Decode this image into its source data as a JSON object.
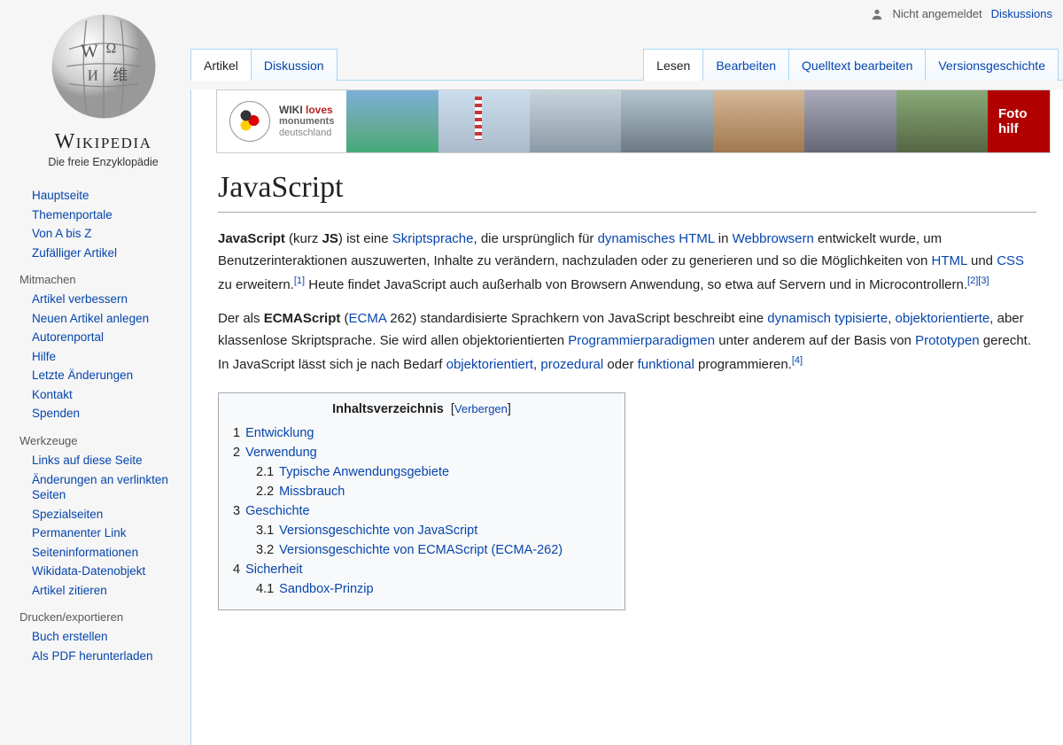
{
  "logo": {
    "wordmark": "Wikipedia",
    "tagline": "Die freie Enzyklopädie"
  },
  "topbar": {
    "not_logged_in": "Nicht angemeldet",
    "talk": "Diskussions"
  },
  "nav": {
    "main": [
      "Hauptseite",
      "Themenportale",
      "Von A bis Z",
      "Zufälliger Artikel"
    ],
    "mitmachen_h": "Mitmachen",
    "mitmachen": [
      "Artikel verbessern",
      "Neuen Artikel anlegen",
      "Autorenportal",
      "Hilfe",
      "Letzte Änderungen",
      "Kontakt",
      "Spenden"
    ],
    "werkzeuge_h": "Werkzeuge",
    "werkzeuge": [
      "Links auf diese Seite",
      "Änderungen an verlinkten Seiten",
      "Spezialseiten",
      "Permanenter Link",
      "Seiteninformationen",
      "Wikidata-Datenobjekt",
      "Artikel zitieren"
    ],
    "drucken_h": "Drucken/exportieren",
    "drucken": [
      "Buch erstellen",
      "Als PDF herunterladen"
    ]
  },
  "tabs": {
    "left": [
      "Artikel",
      "Diskussion"
    ],
    "right": [
      "Lesen",
      "Bearbeiten",
      "Quelltext bearbeiten",
      "Versionsgeschichte"
    ]
  },
  "notice": {
    "line1a": "WIKI",
    "line1b": "loves",
    "line2": "monuments",
    "line3": "deutschland",
    "cta1": "Foto",
    "cta2": "hilf"
  },
  "article": {
    "title": "JavaScript",
    "p1": {
      "a": "JavaScript",
      "b": " (kurz ",
      "c": "JS",
      "d": ") ist eine ",
      "l1": "Skriptsprache",
      "e": ", die ursprünglich für ",
      "l2": "dynamisches HTML",
      "f": " in ",
      "l3": "Webbrowsern",
      "g": " entwickelt wurde, um Benutzerinteraktionen auszuwerten, Inhalte zu verändern, nachzuladen oder zu generieren und so die Möglichkeiten von ",
      "l4": "HTML",
      "h": " und ",
      "l5": "CSS",
      "i": " zu erweitern.",
      "r1": "[1]",
      "j": " Heute findet JavaScript auch außerhalb von Browsern Anwendung, so etwa auf Servern und in Microcontrollern.",
      "r2": "[2]",
      "r3": "[3]"
    },
    "p2": {
      "a": "Der als ",
      "b": "ECMAScript",
      "c": " (",
      "l1": "ECMA",
      "d": " 262) standardisierte Sprachkern von JavaScript beschreibt eine ",
      "l2": "dynamisch typisierte",
      "e": ", ",
      "l3": "objektorientierte",
      "f": ", aber klassenlose Skriptsprache. Sie wird allen objektorientierten ",
      "l4": "Programmierparadigmen",
      "g": " unter anderem auf der Basis von ",
      "l5": "Prototypen",
      "h": " gerecht. In JavaScript lässt sich je nach Bedarf ",
      "l6": "objektorientiert",
      "i": ", ",
      "l7": "prozedural",
      "j": " oder ",
      "l8": "funktional",
      "k": " programmieren.",
      "r1": "[4]"
    }
  },
  "toc": {
    "title": "Inhaltsverzeichnis",
    "hide": "Verbergen",
    "items": [
      {
        "n": "1",
        "t": "Entwicklung"
      },
      {
        "n": "2",
        "t": "Verwendung"
      },
      {
        "n": "2.1",
        "t": "Typische Anwendungsgebiete",
        "sub": true
      },
      {
        "n": "2.2",
        "t": "Missbrauch",
        "sub": true
      },
      {
        "n": "3",
        "t": "Geschichte"
      },
      {
        "n": "3.1",
        "t": "Versionsgeschichte von JavaScript",
        "sub": true
      },
      {
        "n": "3.2",
        "t": "Versionsgeschichte von ECMAScript (ECMA-262)",
        "sub": true
      },
      {
        "n": "4",
        "t": "Sicherheit"
      },
      {
        "n": "4.1",
        "t": "Sandbox-Prinzip",
        "sub": true
      }
    ]
  }
}
